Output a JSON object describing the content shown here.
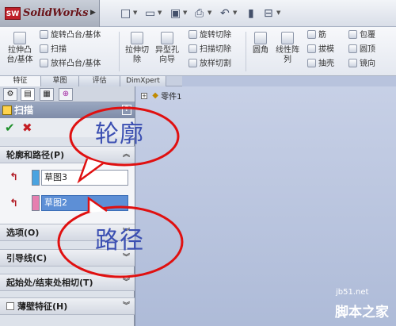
{
  "app": {
    "title": "SolidWorks",
    "logo_badge": "SW"
  },
  "quick_access": [
    "□",
    "▭",
    "▣",
    "⎙",
    "↶",
    "▮",
    "⊟"
  ],
  "ribbon": {
    "big": [
      {
        "label": "拉伸凸台/基体",
        "name": "extruded-boss-button"
      },
      {
        "label": "拉伸切除",
        "name": "extruded-cut-button"
      },
      {
        "label": "异型孔向导",
        "name": "hole-wizard-button"
      },
      {
        "label": "圆角",
        "name": "fillet-button"
      },
      {
        "label": "线性阵列",
        "name": "linear-pattern-button"
      }
    ],
    "small": [
      {
        "label": "旋转凸台/基体",
        "name": "revolved-boss-button"
      },
      {
        "label": "扫描",
        "name": "sweep-button"
      },
      {
        "label": "放样凸台/基体",
        "name": "lofted-boss-button"
      },
      {
        "label": "旋转切除",
        "name": "revolved-cut-button"
      },
      {
        "label": "扫描切除",
        "name": "swept-cut-button"
      },
      {
        "label": "放样切割",
        "name": "lofted-cut-button"
      },
      {
        "label": "筋",
        "name": "rib-button"
      },
      {
        "label": "拔模",
        "name": "draft-button"
      },
      {
        "label": "抽壳",
        "name": "shell-button"
      },
      {
        "label": "包覆",
        "name": "wrap-button"
      },
      {
        "label": "圆顶",
        "name": "dome-button"
      },
      {
        "label": "镜向",
        "name": "mirror-button"
      }
    ]
  },
  "cm_tabs": [
    "特征",
    "草图",
    "评估",
    "DimXpert"
  ],
  "tree": {
    "part": "零件1"
  },
  "pm": {
    "tabs": [
      "⚙",
      "▤",
      "▦",
      "⊕"
    ],
    "title": "扫描",
    "help": "?",
    "ok": "✔",
    "cancel": "✖",
    "sections": {
      "profile_path": "轮廓和路径(P)",
      "options": "选项(O)",
      "guides": "引导线(C)",
      "tangency": "起始处/结束处相切(T)",
      "thin": "薄壁特征(H)"
    },
    "profile_value": "草图3",
    "path_value": "草图2",
    "profile_color": "#4aa3e0",
    "path_color": "#e67fb0"
  },
  "callouts": {
    "profile": "轮廓",
    "path": "路径"
  },
  "watermark": {
    "site": "jb51.net",
    "brand": "脚本之家"
  }
}
